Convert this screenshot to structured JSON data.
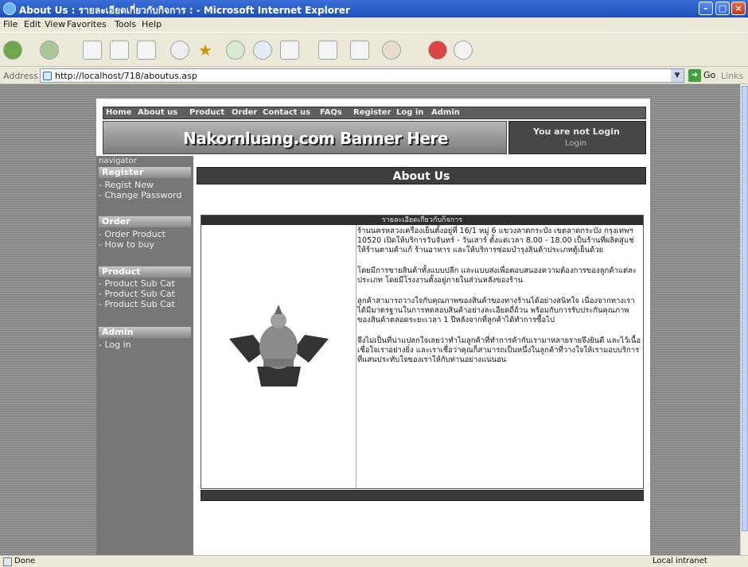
{
  "window": {
    "title": "About Us : รายละเอียดเกี่ยวกับกิจการ : - Microsoft Internet Explorer"
  },
  "menu": [
    "File",
    "Edit",
    "View",
    "Favorites",
    "Tools",
    "Help"
  ],
  "address": {
    "label": "Address",
    "url": "http://localhost/718/aboutus.asp",
    "go": "Go",
    "links": "Links"
  },
  "topnav": [
    "Home",
    "About us",
    "Product",
    "Order",
    "Contact us",
    "FAQs",
    "Register",
    "Log in",
    "Admin"
  ],
  "banner": {
    "text": "Nakornluang.com Banner Here"
  },
  "login": {
    "status": "You are not Login",
    "sub": "Login"
  },
  "sidebar": {
    "header": "navigator",
    "sections": [
      {
        "title": "Register",
        "items": [
          "- Regist New",
          "- Change Password"
        ]
      },
      {
        "title": "Order",
        "items": [
          "- Order Product",
          "- How to buy"
        ]
      },
      {
        "title": "Product",
        "items": [
          "- Product Sub Cat",
          "- Product Sub Cat",
          "- Product Sub Cat"
        ]
      },
      {
        "title": "Admin",
        "items": [
          "- Log in"
        ]
      }
    ]
  },
  "main": {
    "title": "About Us",
    "box_header": "รายละเอียดเกี่ยวกับกิจการ",
    "paragraphs": [
      "ร้านนครหลวงเครื่องเย็นตั้งอยู่ที่ 16/1 หมู่ 6 แขวงลาดกระบัง เขตลาดกระบัง กรุงเทพฯ 10520 เปิดให้บริการวันจันทร์ - วันเสาร์ ตั้งแต่เวลา 8.00 - 18.00 เป็นร้านที่ผลิตสู่แช่ให้ร้านตามค้าแก้ ร้านอาหาร และให้บริการซ่อมบำรุงสินค้าประเภทตู้เย็นด้วย",
      "โดยมีการขายสินค้าทั้งแบบปลีก และแบบส่งเพื่อตอบสนองความต้องการของลูกค้าแต่ละประเภท โดยมีโรงงานตั้งอยู่ภายในส่วนหลังของร้าน",
      "ลูกค้าสามารถวางใจกับคุณภาพของสินค้าของทางร้านได้อย่างสนิทใจ เนื่องจากทางเราได้มีมาตรฐานในการทดสอบสินค้าอย่างละเอียดถี่ถ้วน พร้อมกับการรับประกันคุณภาพของสินค้าตลอดระยะเวลา 1 ปีหลังจากที่ลูกค้าได้ทำการซื้อไป",
      "จึงไม่เป็นที่น่าแปลกใจเลยว่าทำไมลูกค้าที่ทำการค้ากับเรามาหลายรายจึงยินดี และไว้เนื้อเชื่อใจเราอย่างยิ่ง และเราเชื่อว่าคุณก็สามารถเป็นหนึ่งในลูกค้าที่วางใจให้เรามอบบริการที่แสนประทับใจของเราให้กับท่านอย่างแน่นอน"
    ]
  },
  "status": {
    "text": "Done",
    "zone": "Local intranet"
  }
}
